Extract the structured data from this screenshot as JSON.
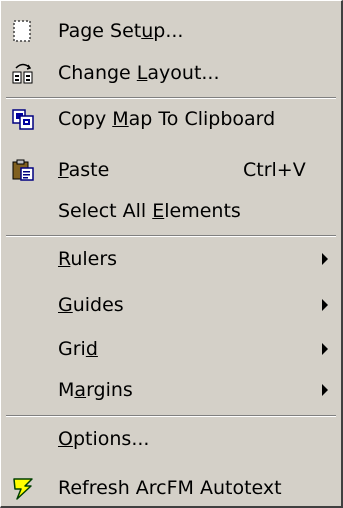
{
  "menu": {
    "items": [
      {
        "pre": "Page Set",
        "acc": "u",
        "post": "p...",
        "icon": "page-setup-icon"
      },
      {
        "pre": "Change ",
        "acc": "L",
        "post": "ayout...",
        "icon": "change-layout-icon"
      },
      {
        "pre": "Copy ",
        "acc": "M",
        "post": "ap To Clipboard",
        "icon": "copy-map-icon"
      },
      {
        "pre": "",
        "acc": "P",
        "post": "aste",
        "icon": "paste-icon",
        "shortcut": "Ctrl+V"
      },
      {
        "pre": "Select All ",
        "acc": "E",
        "post": "lements"
      },
      {
        "pre": "",
        "acc": "R",
        "post": "ulers",
        "submenu": true
      },
      {
        "pre": "",
        "acc": "G",
        "post": "uides",
        "submenu": true
      },
      {
        "pre": "Gri",
        "acc": "d",
        "post": "",
        "submenu": true
      },
      {
        "pre": "M",
        "acc": "a",
        "post": "rgins",
        "submenu": true
      },
      {
        "pre": "",
        "acc": "O",
        "post": "ptions..."
      },
      {
        "pre": "Refresh ArcFM Autotext",
        "acc": "",
        "post": "",
        "icon": "lightning-icon"
      }
    ]
  }
}
